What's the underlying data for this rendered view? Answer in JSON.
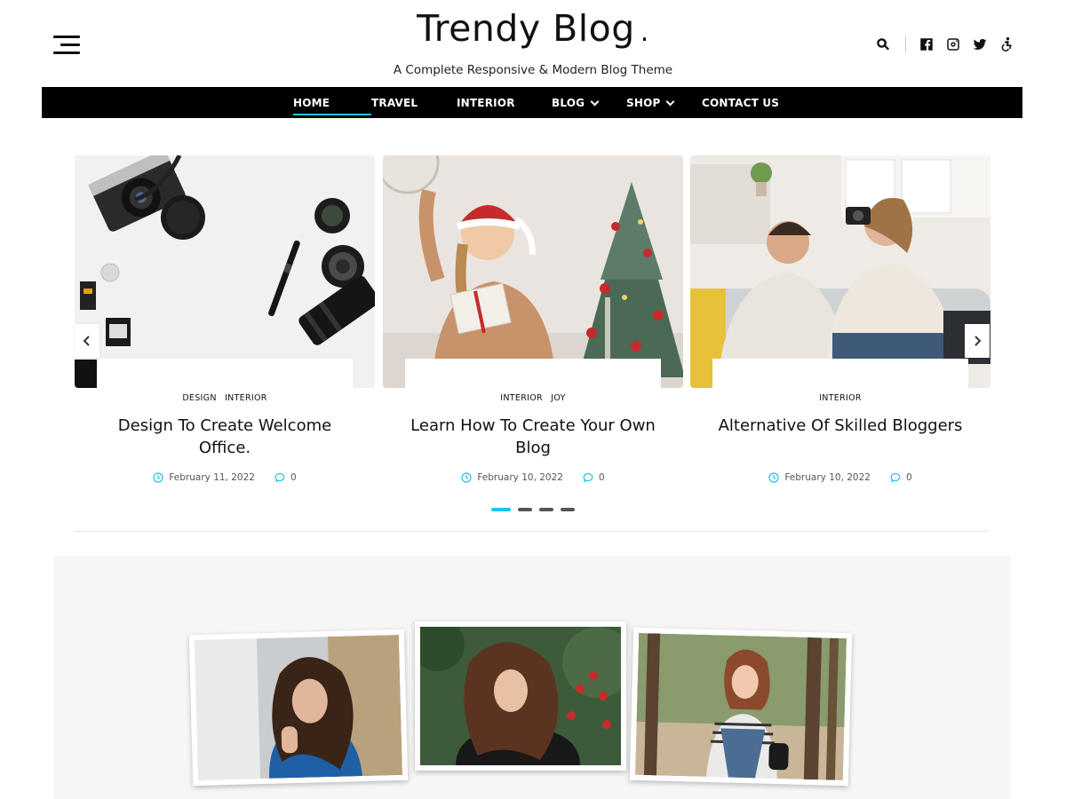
{
  "header": {
    "title": "Trendy Blog",
    "title_dot": ".",
    "tagline": "A Complete Responsive & Modern Blog Theme",
    "icons": [
      "menu-icon",
      "search-icon",
      "facebook-icon",
      "instagram-icon",
      "twitter-icon",
      "accessibility-icon"
    ]
  },
  "nav": {
    "items": [
      {
        "label": "HOME",
        "active": true
      },
      {
        "label": "TRAVEL"
      },
      {
        "label": "INTERIOR"
      },
      {
        "label": "BLOG",
        "dropdown": true
      },
      {
        "label": "SHOP",
        "dropdown": true
      },
      {
        "label": "CONTACT US"
      }
    ]
  },
  "slider": {
    "slides": [
      {
        "categories": [
          "DESIGN",
          "INTERIOR"
        ],
        "title": "Design To Create Welcome Office.",
        "date": "February 11, 2022",
        "comments": "0"
      },
      {
        "categories": [
          "INTERIOR",
          "JOY"
        ],
        "title": "Learn How To Create Your Own Blog",
        "date": "February 10, 2022",
        "comments": "0"
      },
      {
        "categories": [
          "INTERIOR"
        ],
        "title": "Alternative Of Skilled Bloggers",
        "date": "February 10, 2022",
        "comments": "0"
      }
    ],
    "pagination": {
      "count": 4,
      "active": 1
    }
  },
  "colors": {
    "accent": "#1cc6e6",
    "nav_bg": "#000000",
    "text": "#111111",
    "gallery_bg": "#f6f6f6"
  }
}
